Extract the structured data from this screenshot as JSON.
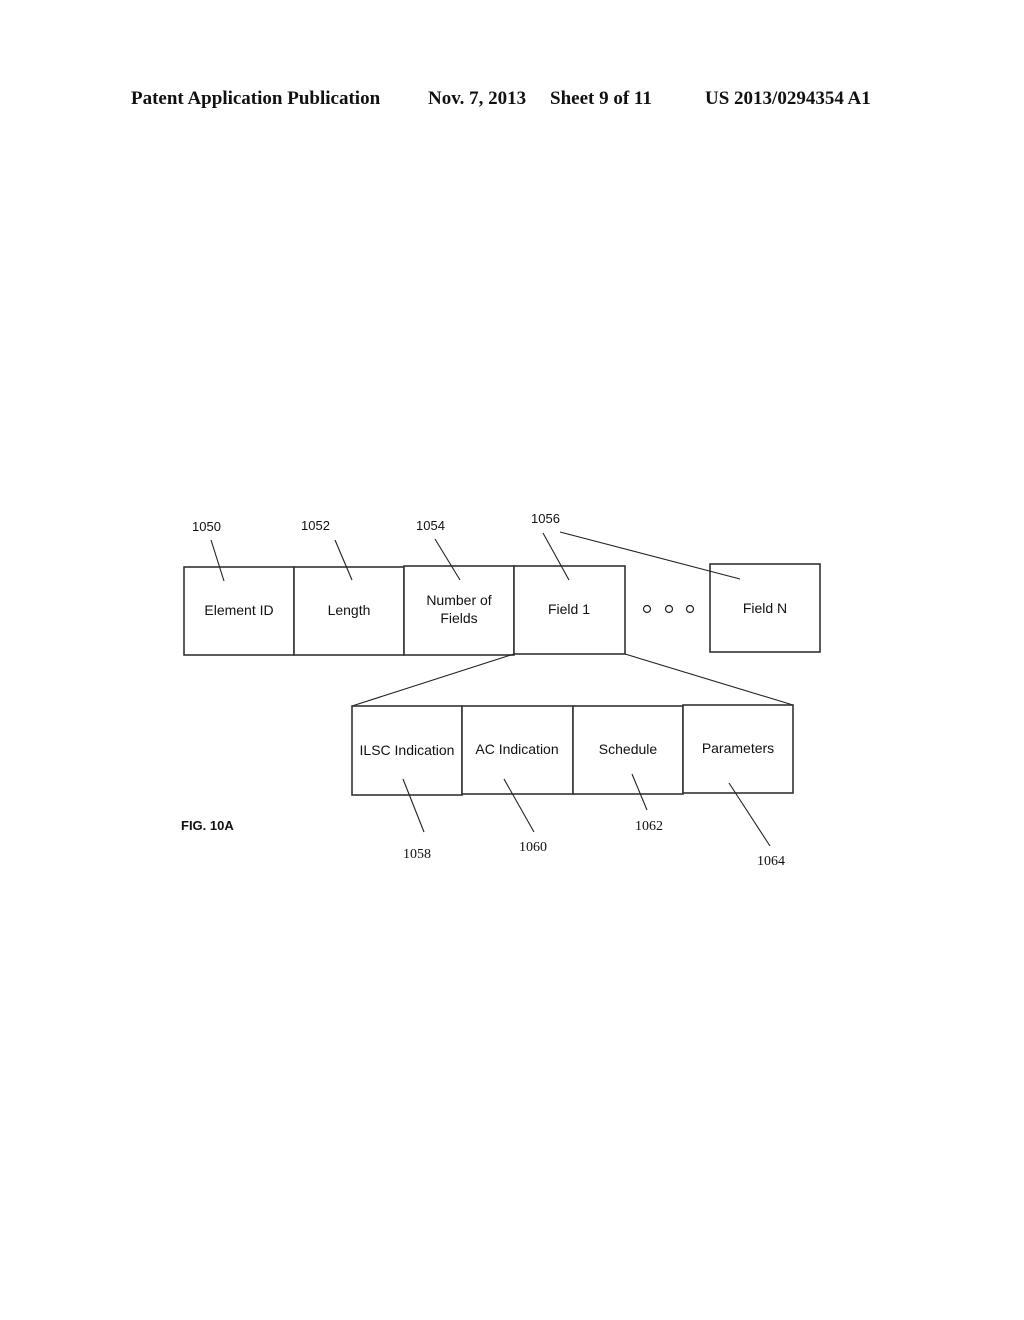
{
  "header": {
    "publication": "Patent Application Publication",
    "date": "Nov. 7, 2013",
    "sheet": "Sheet 9 of 11",
    "number": "US 2013/0294354 A1"
  },
  "figure": {
    "label": "FIG. 10A",
    "top_row": [
      {
        "ref": "1050",
        "lines": [
          "Element ID"
        ]
      },
      {
        "ref": "1052",
        "lines": [
          "Length"
        ]
      },
      {
        "ref": "1054",
        "lines": [
          "Number of",
          "Fields"
        ]
      },
      {
        "ref": "1056",
        "lines": [
          "Field 1"
        ]
      }
    ],
    "ellipsis": "o o o",
    "last_field": {
      "lines": [
        "Field N"
      ]
    },
    "sub_row": [
      {
        "ref": "1058",
        "lines": [
          "ILSC Indication"
        ]
      },
      {
        "ref": "1060",
        "lines": [
          "AC Indication"
        ]
      },
      {
        "ref": "1062",
        "lines": [
          "Schedule"
        ]
      },
      {
        "ref": "1064",
        "lines": [
          "Parameters"
        ]
      }
    ]
  }
}
